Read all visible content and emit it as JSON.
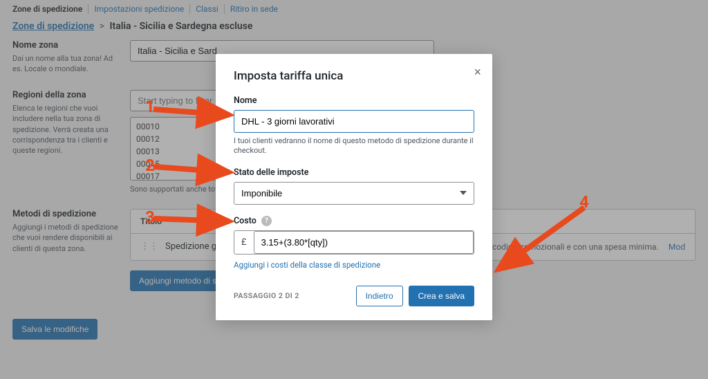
{
  "tabs": [
    "Zone di spedizione",
    "Impostazioni spedizione",
    "Classi",
    "Ritiro in sede"
  ],
  "breadcrumb": {
    "root": "Zone di spedizione",
    "current": "Italia - Sicilia e Sardegna escluse"
  },
  "fields": {
    "zone_name": {
      "label": "Nome zona",
      "help": "Dai un nome alla tua zona! Ad es. Locale o mondiale.",
      "value": "Italia - Sicilia e Sard"
    },
    "zone_regions": {
      "label": "Regioni della zona",
      "help": "Elenca le regioni che vuoi includere nella tua zona di spedizione. Verrà creata una corrispondenza tra i clienti e queste regioni.",
      "filter_placeholder": "Start typing to filter",
      "items": [
        "00010",
        "00012",
        "00013",
        "00015",
        "00017"
      ],
      "hint": "Sono supportati anche\ntotalmente numerici (a\nzone di spedizione"
    },
    "methods": {
      "label": "Metodi di spedizione",
      "help": "Aggiungi i metodi di spedizione che vuoi rendere disponibili ai clienti di questa zona.",
      "col_title": "Titolo",
      "row_title": "Spedizione gratuita",
      "row_desc": "e che può essere attivato con codici promozionali e con una spesa minima.",
      "mod": "Mod"
    }
  },
  "buttons": {
    "add_method": "Aggiungi metodo di spedizione",
    "save": "Salva le modifiche"
  },
  "modal": {
    "title": "Imposta tariffa unica",
    "name_label": "Nome",
    "name_value": "DHL - 3 giorni lavorativi",
    "name_help": "I tuoi clienti vedranno il nome di questo metodo di spedizione durante il checkout.",
    "tax_label": "Stato delle imposte",
    "tax_value": "Imponibile",
    "cost_label": "Costo",
    "cost_currency": "£",
    "cost_value": "3.15+(3.80*[qty])",
    "cost_link": "Aggiungi i costi della classe di spedizione",
    "step": "PASSAGGIO 2 DI 2",
    "back": "Indietro",
    "submit": "Crea e salva"
  },
  "annotations": {
    "n1": "1",
    "n2": "2",
    "n3": "3",
    "n4": "4"
  },
  "colors": {
    "accent": "#2271b1",
    "annotation": "#e8491d"
  }
}
